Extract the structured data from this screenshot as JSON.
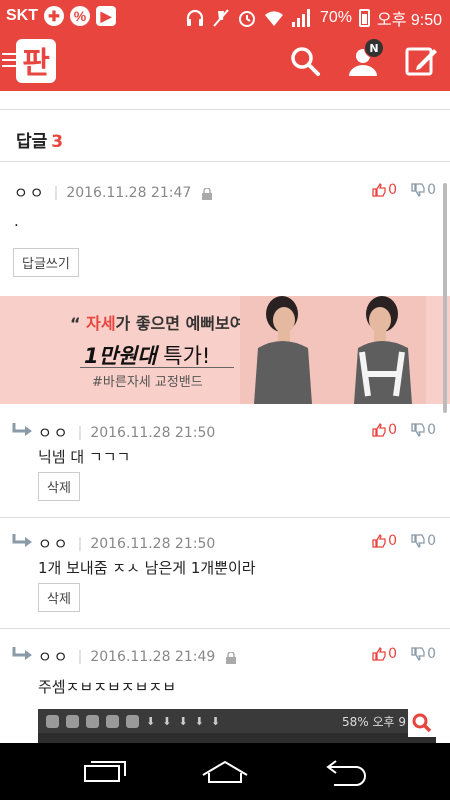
{
  "status_bar": {
    "carrier": "SKT",
    "battery_percent": "70%",
    "time": "오후 9:50"
  },
  "app_bar": {
    "logo_text": "판",
    "notification_badge": "N"
  },
  "replies": {
    "label": "답글",
    "count": "3"
  },
  "comments": [
    {
      "author": "ㅇㅇ",
      "datetime": "2016.11.28 21:47",
      "body": ".",
      "likes": "0",
      "dislikes": "0",
      "button_label": "답글쓰기"
    },
    {
      "author": "ㅇㅇ",
      "datetime": "2016.11.28 21:50",
      "body": "닉넴 대 ㄱㄱㄱ",
      "likes": "0",
      "dislikes": "0",
      "button_label": "삭제"
    },
    {
      "author": "ㅇㅇ",
      "datetime": "2016.11.28 21:50",
      "body": "1개 보내줌 ㅈㅅ 남은게 1개뿐이라",
      "likes": "0",
      "dislikes": "0",
      "button_label": "삭제"
    },
    {
      "author": "ㅇㅇ",
      "datetime": "2016.11.28 21:49",
      "body": "주셈ㅈㅂㅈㅂㅈㅂㅈㅂ",
      "likes": "0",
      "dislikes": "0"
    }
  ],
  "ad": {
    "quote_open": "“",
    "quote_highlight": "자세",
    "quote_rest": "가 좋으면 예뻐보여",
    "quote_close": "”",
    "headline_bold": "1만원대",
    "headline_rest": " 특가!",
    "hashtag": "#바른자세 교정밴드"
  },
  "embedded_screenshot": {
    "status_text": "58% 오후 9"
  },
  "colors": {
    "brand": "#e9453f",
    "ad_bg": "#f9d0c9"
  }
}
